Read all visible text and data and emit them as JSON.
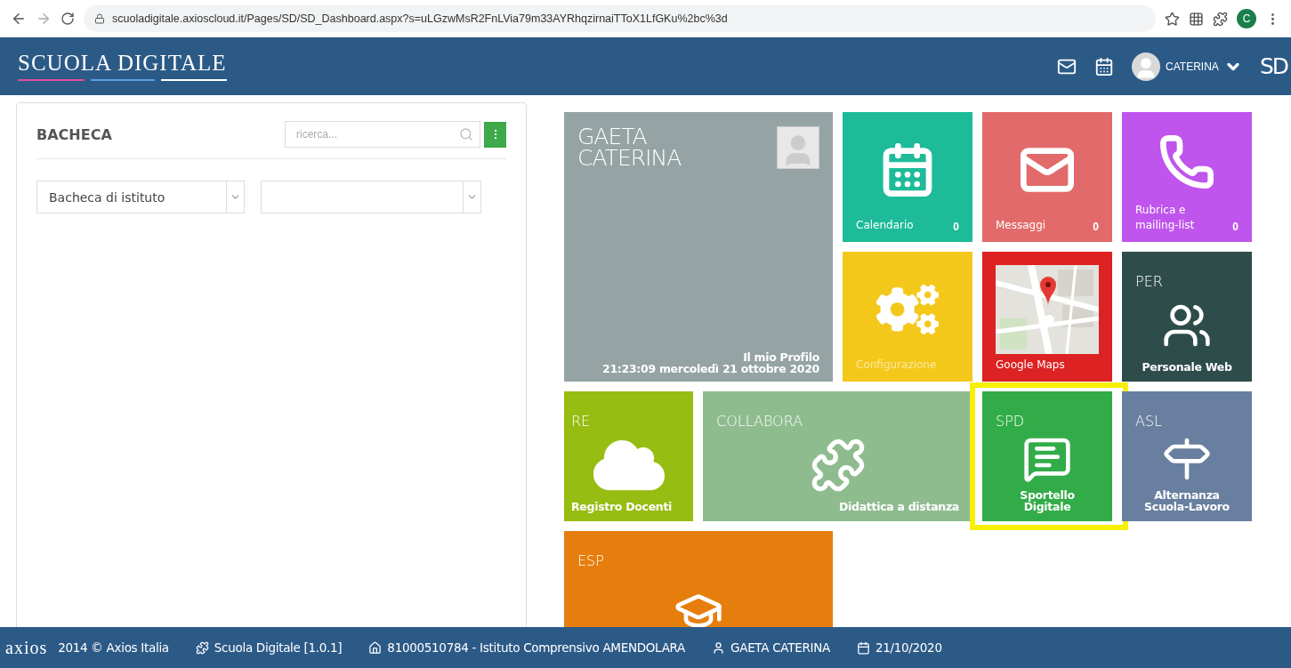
{
  "browser": {
    "url": "scuoladigitale.axioscloud.it/Pages/SD/SD_Dashboard.aspx?s=uLGzwMsR2FnLVia79m33AYRhqzirnaiTToX1LfGKu%2bc%3d",
    "profile_letter": "C"
  },
  "header": {
    "logo": "SCUOLA DIGITALE",
    "user": "CATERINA",
    "brand": "SD"
  },
  "bacheca": {
    "title": "BACHECA",
    "search": {
      "placeholder": "ricerca..."
    },
    "selects": [
      {
        "kind": "dropdown",
        "value": "Bacheca di istituto"
      },
      {
        "kind": "dropdown"
      }
    ]
  },
  "tiles": [
    {
      "kind": "profile",
      "color": "#95a3a4",
      "name": "GAETA CATERINA",
      "label": "Il mio Profilo",
      "datetime": "21:23:09 mercoledì 21 ottobre 2020",
      "highlighted": false
    },
    {
      "kind": "counter",
      "color": "#1dbb99",
      "label": "Calendario",
      "count": "0",
      "highlighted": false
    },
    {
      "kind": "counter",
      "color": "#e26a6a",
      "label": "Messaggi",
      "count": "0",
      "highlighted": false
    },
    {
      "kind": "counter",
      "color": "#bf55ec",
      "label": "Rubrica e mailing-list",
      "count": "0",
      "highlighted": false
    },
    {
      "kind": "plain",
      "color": "#f4c81b",
      "label": "Configurazione",
      "highlighted": false
    },
    {
      "kind": "map",
      "color": "#dc2222",
      "label": "Google Maps",
      "highlighted": false
    },
    {
      "kind": "coded",
      "color": "#2e4c4a",
      "code": "PER",
      "label": "Personale Web",
      "highlighted": false
    },
    {
      "kind": "coded",
      "color": "#97bc12",
      "code": "RE",
      "label": "Registro Docenti",
      "highlighted": false
    },
    {
      "kind": "coded",
      "color": "#8fbc8f",
      "code": "COLLABORA",
      "label": "Didattica a distanza",
      "highlighted": false
    },
    {
      "kind": "coded",
      "color": "#32ac48",
      "code": "SPD",
      "label": "Sportello Digitale",
      "highlighted": true
    },
    {
      "kind": "coded",
      "color": "#687f9f",
      "code": "ASL",
      "label": "Alternanza Scuola-Lavoro",
      "highlighted": false
    },
    {
      "kind": "coded",
      "color": "#e67e0e",
      "code": "ESP",
      "highlighted": false
    }
  ],
  "footer": {
    "logo": "axios",
    "copyright": "2014 © Axios Italia",
    "app": "Scuola Digitale [1.0.1]",
    "school": "81000510784 - Istituto Comprensivo AMENDOLARA",
    "user": "GAETA CATERINA",
    "date": "21/10/2020"
  }
}
